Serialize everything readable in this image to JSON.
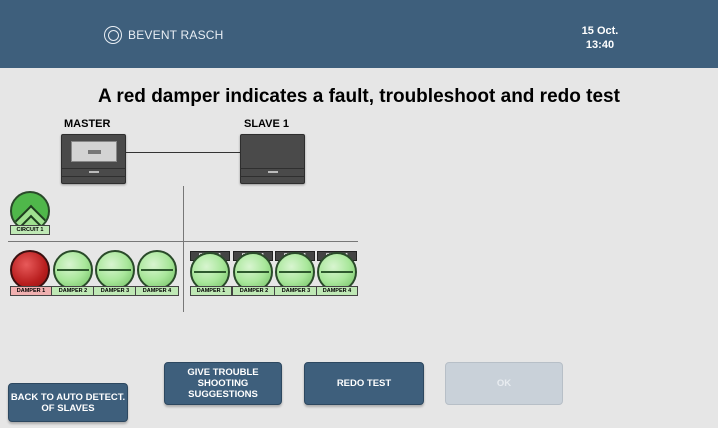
{
  "header": {
    "brand": "BEVENT RASCH",
    "date": "15 Oct.",
    "time": "13:40",
    "colors": {
      "bar": "#3e5f7c"
    }
  },
  "instruction": "A red damper indicates a fault, troubleshoot and redo test",
  "units": {
    "master": "MASTER",
    "slave": "SLAVE 1"
  },
  "circuit": {
    "label": "CIRCUIT 1",
    "status": "ok"
  },
  "master_dampers": [
    {
      "label": "DAMPER 1",
      "status": "fault",
      "color": "#b81e1e"
    },
    {
      "label": "DAMPER 2",
      "status": "ok"
    },
    {
      "label": "DAMPER 3",
      "status": "ok"
    },
    {
      "label": "DAMPER 4",
      "status": "ok"
    }
  ],
  "slave_dampers": [
    {
      "unit": "SLAVE 1",
      "label": "DAMPER 1",
      "status": "ok"
    },
    {
      "unit": "SLAVE 1",
      "label": "DAMPER 2",
      "status": "ok"
    },
    {
      "unit": "SLAVE 1",
      "label": "DAMPER 3",
      "status": "ok"
    },
    {
      "unit": "SLAVE 1",
      "label": "DAMPER 4",
      "status": "ok"
    }
  ],
  "buttons": {
    "back": "BACK TO AUTO DETECT. OF SLAVES",
    "trouble": "GIVE TROUBLE SHOOTING SUGGESTIONS",
    "redo": "REDO TEST",
    "ok": "OK"
  }
}
